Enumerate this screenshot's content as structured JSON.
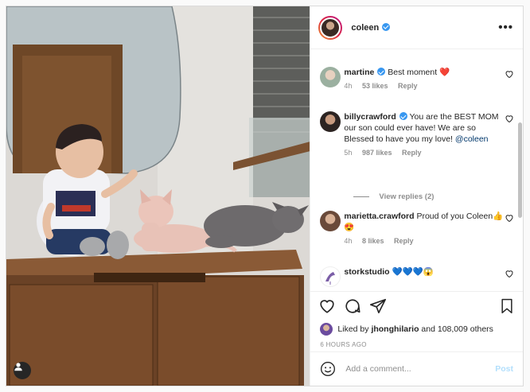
{
  "post": {
    "author": "coleen",
    "more_label": "•••"
  },
  "comments": [
    {
      "user": "martine",
      "text": "Best moment ❤️",
      "time": "4h",
      "likes": "53 likes",
      "reply": "Reply"
    },
    {
      "user": "billycrawford",
      "text": "You are the BEST MOM our son could ever have! We are so Blessed to have you my love! ",
      "mention": "@coleen",
      "time": "5h",
      "likes": "987 likes",
      "reply": "Reply",
      "view_replies": "View replies (2)"
    },
    {
      "user": "marietta.crawford",
      "text": "Proud of you Coleen👍😍",
      "time": "4h",
      "likes": "8 likes",
      "reply": "Reply"
    },
    {
      "user": "storkstudio",
      "text": "💙💙💙😱"
    }
  ],
  "likes": {
    "prefix": "Liked by ",
    "user": "jhonghilario",
    "suffix": " and 108,009 others"
  },
  "timestamp": "6 HOURS AGO",
  "add_comment": {
    "placeholder": "Add a comment...",
    "post_label": "Post"
  },
  "icons": [
    "user-tag-icon",
    "more-icon",
    "heart-icon",
    "comment-icon",
    "share-icon",
    "bookmark-icon",
    "emoji-icon",
    "verified-icon"
  ],
  "colors": {
    "verified": "#3897f0",
    "post_disabled": "#b2dffc",
    "mention": "#00376b",
    "heart_red": "#ed4956"
  }
}
